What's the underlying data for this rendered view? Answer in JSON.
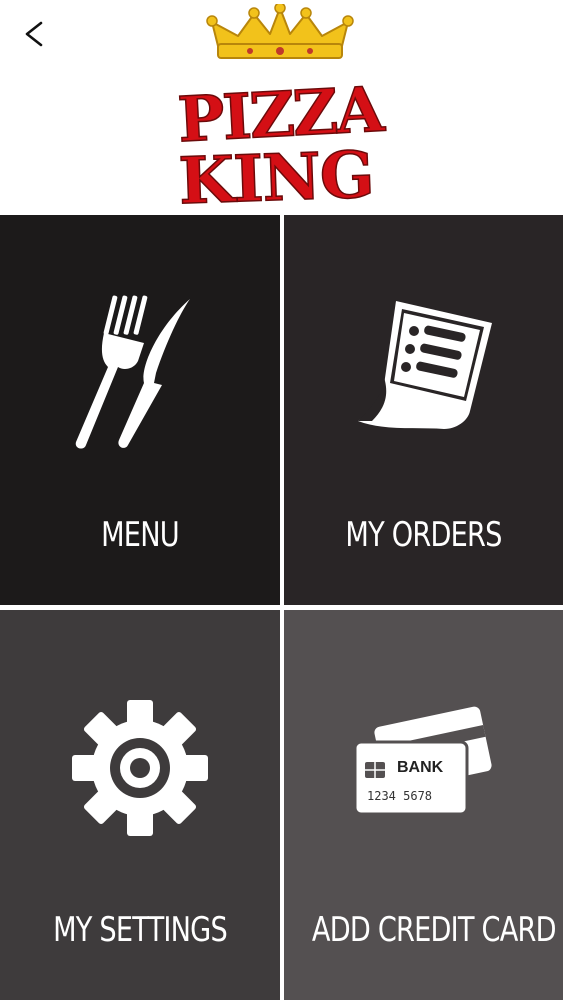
{
  "header": {
    "back_icon": "chevron-left-icon",
    "logo": {
      "line1": "PIZZA",
      "line2": "KING",
      "crown_color": "#f2c21b",
      "text_color": "#d40f15"
    }
  },
  "tiles": [
    {
      "label": "MENU",
      "icon": "fork-knife-icon"
    },
    {
      "label": "MY ORDERS",
      "icon": "receipt-icon"
    },
    {
      "label": "MY SETTINGS",
      "icon": "gear-icon"
    },
    {
      "label": "ADD CREDIT CARD",
      "icon": "credit-card-icon"
    }
  ],
  "card_icon": {
    "bank_text": "BANK",
    "number_text": "1234 5678"
  },
  "colors": {
    "tile_menu": "#1c1a1a",
    "tile_orders": "#292526",
    "tile_settings": "#3e3b3c",
    "tile_card": "#545051",
    "icon": "#ffffff"
  }
}
